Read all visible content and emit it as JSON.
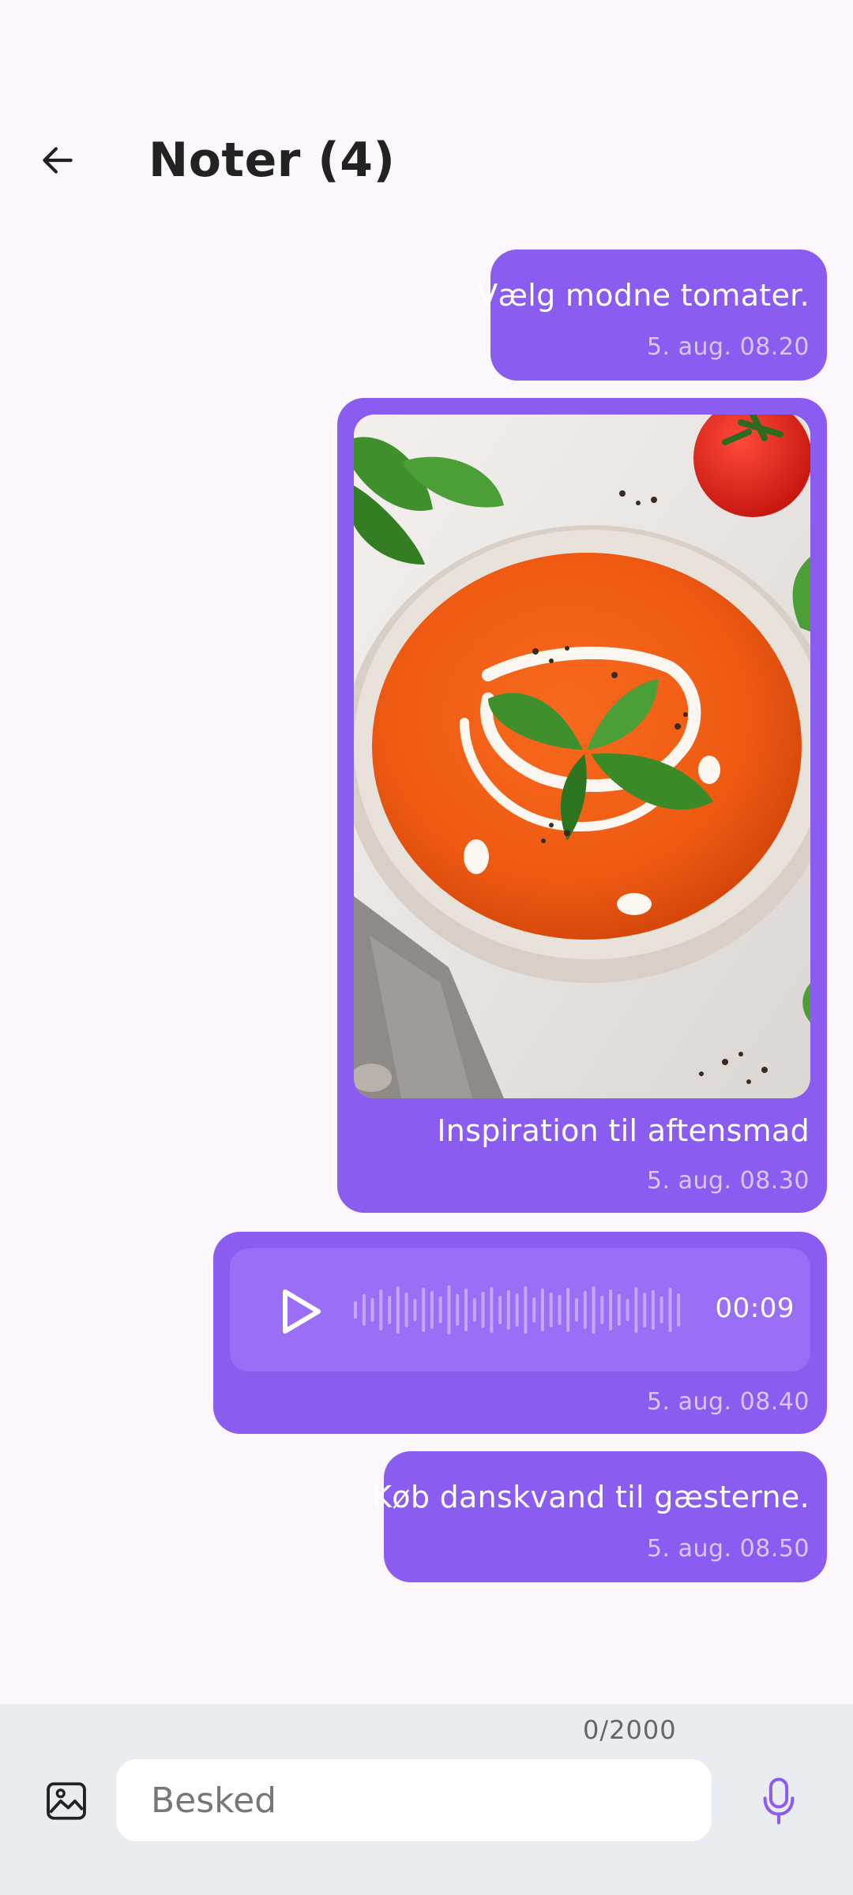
{
  "header": {
    "title": "Noter (4)",
    "back_icon": "arrow-left-icon"
  },
  "messages": [
    {
      "type": "text",
      "text": "Vælg modne tomater.",
      "time": "5. aug. 08.20"
    },
    {
      "type": "image",
      "image": "tomato-soup-photo",
      "caption": "Inspiration til aftensmad",
      "time": "5. aug. 08.30"
    },
    {
      "type": "audio",
      "play_icon": "play-icon",
      "duration": "00:09",
      "time": "5. aug. 08.40"
    },
    {
      "type": "text",
      "text": "Køb danskvand til gæsterne.",
      "time": "5. aug. 08.50"
    }
  ],
  "composer": {
    "counter": "0/2000",
    "placeholder": "Besked",
    "value": "",
    "gallery_icon": "image-icon",
    "mic_icon": "microphone-icon"
  },
  "colors": {
    "background": "#fcf6fd",
    "bubble": "#8b5cf0",
    "timestamp": "#d8c8ff",
    "footer": "#e9ecf1",
    "accent": "#8b5cf0"
  }
}
